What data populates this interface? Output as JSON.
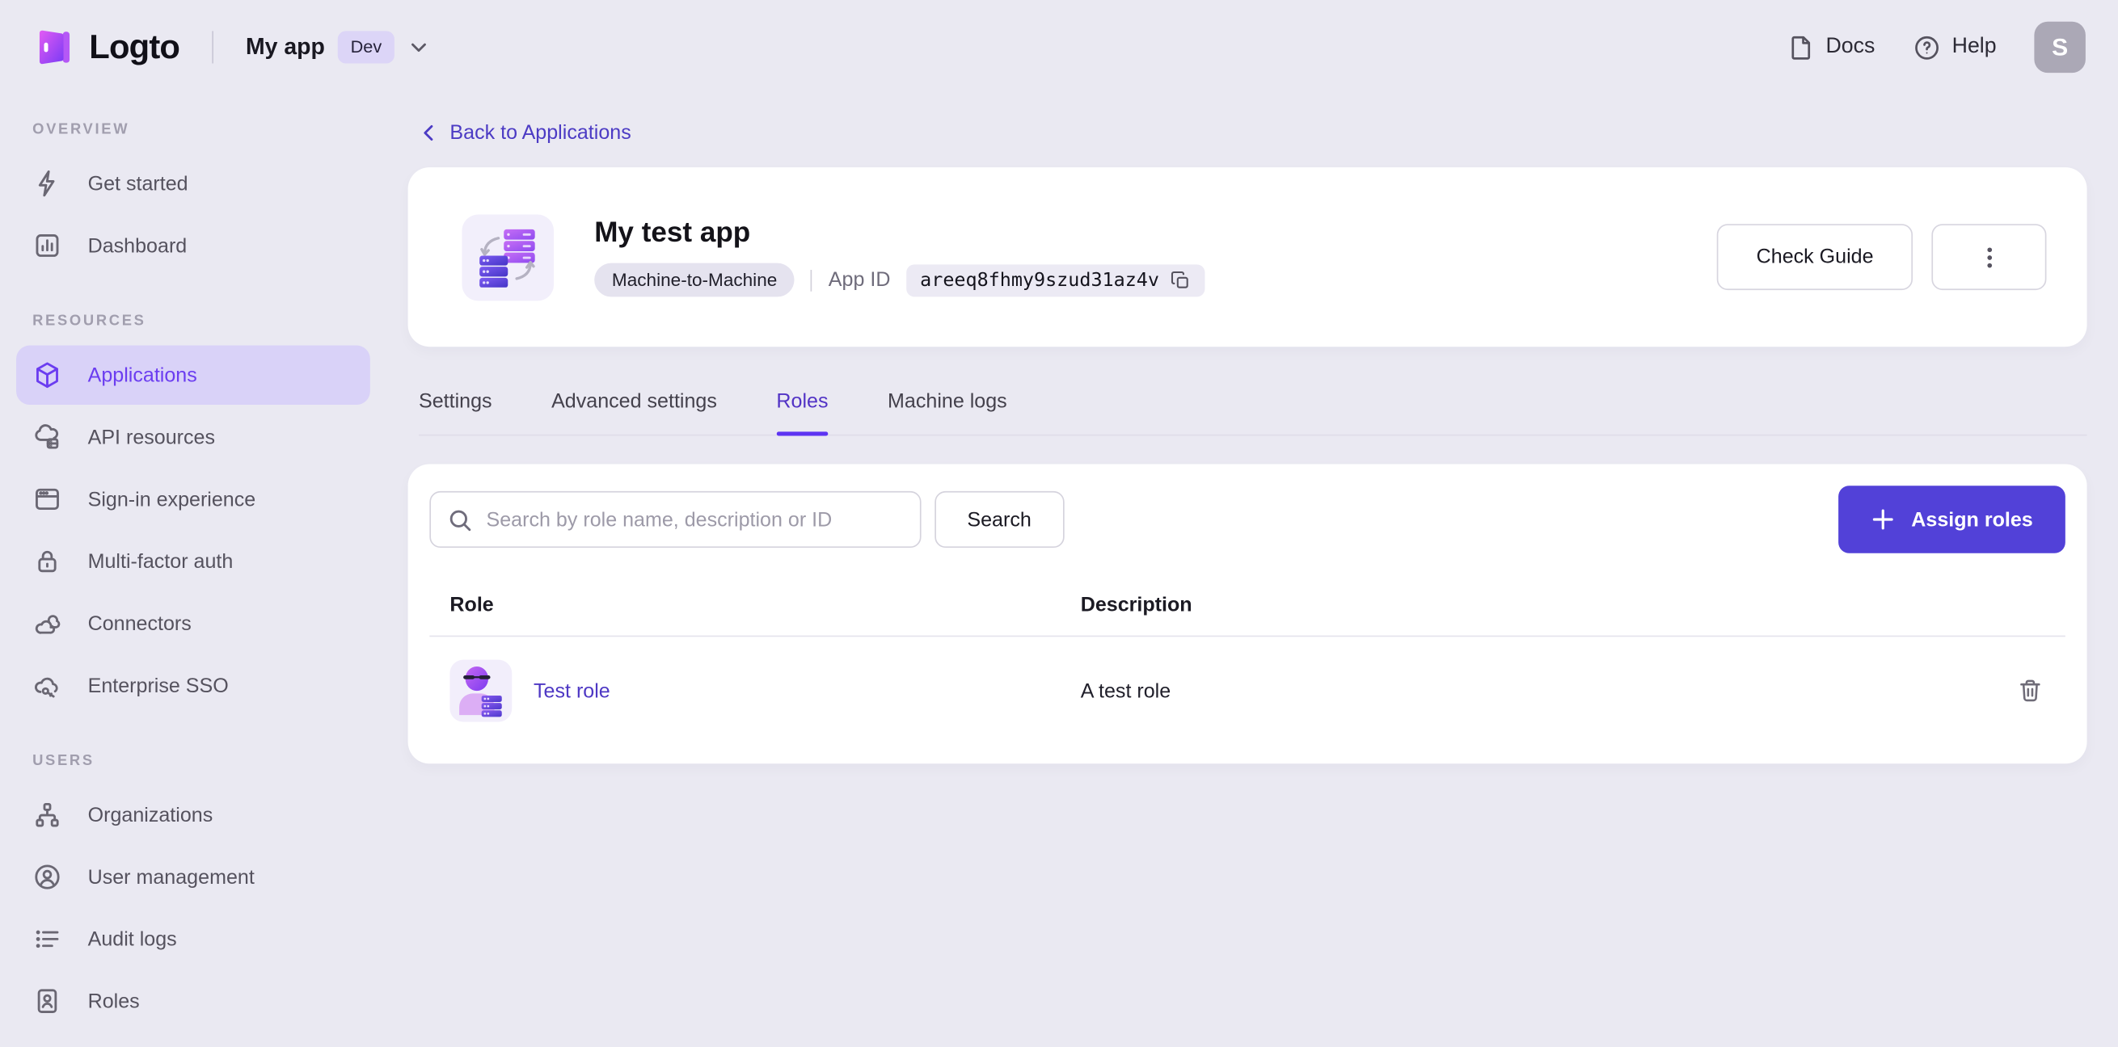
{
  "topbar": {
    "logo_text": "Logto",
    "tenant_name": "My app",
    "tenant_badge": "Dev",
    "docs_label": "Docs",
    "help_label": "Help",
    "avatar_initial": "S"
  },
  "sidebar": {
    "sections": [
      {
        "label": "OVERVIEW",
        "items": [
          {
            "label": "Get started",
            "icon": "lightning-icon",
            "active": false
          },
          {
            "label": "Dashboard",
            "icon": "dashboard-icon",
            "active": false
          }
        ]
      },
      {
        "label": "RESOURCES",
        "items": [
          {
            "label": "Applications",
            "icon": "cube-icon",
            "active": true
          },
          {
            "label": "API resources",
            "icon": "api-resources-icon",
            "active": false
          },
          {
            "label": "Sign-in experience",
            "icon": "sign-in-icon",
            "active": false
          },
          {
            "label": "Multi-factor auth",
            "icon": "lock-icon",
            "active": false
          },
          {
            "label": "Connectors",
            "icon": "connectors-icon",
            "active": false
          },
          {
            "label": "Enterprise SSO",
            "icon": "enterprise-sso-icon",
            "active": false
          }
        ]
      },
      {
        "label": "USERS",
        "items": [
          {
            "label": "Organizations",
            "icon": "organizations-icon",
            "active": false
          },
          {
            "label": "User management",
            "icon": "user-icon",
            "active": false
          },
          {
            "label": "Audit logs",
            "icon": "audit-logs-icon",
            "active": false
          },
          {
            "label": "Roles",
            "icon": "roles-icon",
            "active": false
          }
        ]
      }
    ]
  },
  "main": {
    "back_link": "Back to Applications",
    "app": {
      "title": "My test app",
      "type_badge": "Machine-to-Machine",
      "app_id_label": "App ID",
      "app_id_value": "areeq8fhmy9szud31az4v",
      "check_guide_label": "Check Guide"
    },
    "tabs": [
      {
        "label": "Settings",
        "active": false
      },
      {
        "label": "Advanced settings",
        "active": false
      },
      {
        "label": "Roles",
        "active": true
      },
      {
        "label": "Machine logs",
        "active": false
      }
    ],
    "roles_panel": {
      "search_placeholder": "Search by role name, description or ID",
      "search_button": "Search",
      "assign_button": "Assign roles",
      "table": {
        "columns": [
          "Role",
          "Description"
        ],
        "rows": [
          {
            "role": "Test role",
            "description": "A test role"
          }
        ]
      }
    }
  },
  "colors": {
    "page_bg": "#eae9f2",
    "accent": "#5d34f2",
    "primary_button": "#5241d8",
    "link": "#4e38c4",
    "sidebar_active_bg": "#d9d2f8",
    "sidebar_active_text": "#6b3df0"
  }
}
